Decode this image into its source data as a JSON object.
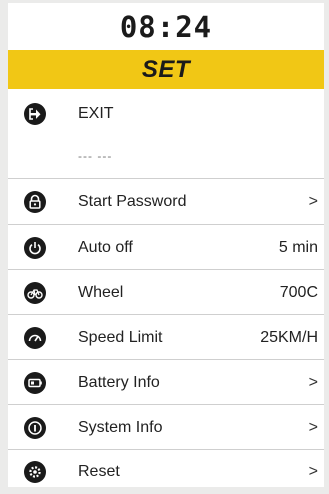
{
  "status_bar": {
    "time": "08:24"
  },
  "header": {
    "title": "SET"
  },
  "menu": {
    "exit": {
      "label": "EXIT",
      "icon": "exit-icon"
    },
    "placeholder": {
      "text": "--- ---"
    },
    "items": [
      {
        "label": "Start Password",
        "value": "",
        "chevron": ">",
        "icon": "lock-icon"
      },
      {
        "label": "Auto off",
        "value": "5 min",
        "chevron": "",
        "icon": "power-icon"
      },
      {
        "label": "Wheel",
        "value": "700C",
        "chevron": "",
        "icon": "bicycle-icon"
      },
      {
        "label": "Speed Limit",
        "value": "25KM/H",
        "chevron": "",
        "icon": "speedometer-icon"
      },
      {
        "label": "Battery Info",
        "value": "",
        "chevron": ">",
        "icon": "battery-icon"
      },
      {
        "label": "System Info",
        "value": "",
        "chevron": ">",
        "icon": "info-icon"
      },
      {
        "label": "Reset",
        "value": "",
        "chevron": ">",
        "icon": "gear-icon"
      }
    ]
  },
  "colors": {
    "accent": "#f1c715",
    "icon": "#1a1a1a",
    "background": "#ffffff"
  }
}
